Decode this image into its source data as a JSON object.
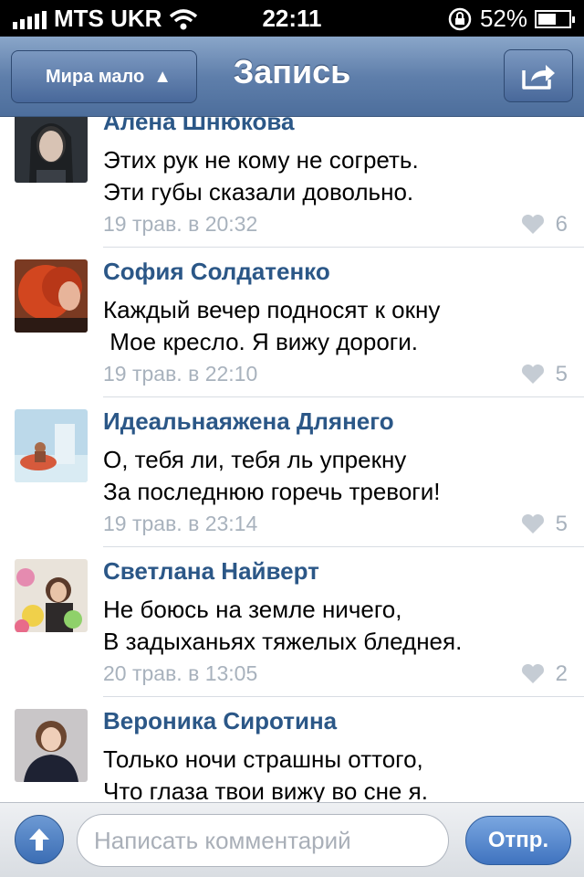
{
  "status_bar": {
    "carrier": "MTS UKR",
    "time": "22:11",
    "battery": "52%",
    "battery_level": 0.52,
    "signal_icon": "signal-bars-icon",
    "wifi_icon": "wifi-icon",
    "rotation_lock_icon": "rotation-lock-icon"
  },
  "nav": {
    "back_label": "Мира мало",
    "back_triangle": "▲",
    "title": "Запись",
    "share_icon": "share-icon"
  },
  "comments": [
    {
      "author": "Алена Шнюкова",
      "text": "Этих рук не кому не согреть.\nЭти губы сказали довольно.",
      "date": "19 трав. в 20:32",
      "likes": "6"
    },
    {
      "author": "София Солдатенко",
      "text": "Каждый вечер подносят к окну\n Мое кресло. Я вижу дороги.",
      "date": "19 трав. в 22:10",
      "likes": "5"
    },
    {
      "author": "Идеальнаяжена Длянего",
      "text": "О, тебя ли, тебя ль упрекну\nЗа последнюю горечь тревоги!",
      "date": "19 трав. в 23:14",
      "likes": "5"
    },
    {
      "author": "Светлана Найверт",
      "text": "Не боюсь на земле ничего,\nВ задыханьях тяжелых бледнея.",
      "date": "20 трав. в 13:05",
      "likes": "2"
    },
    {
      "author": "Вероника Сиротина",
      "text": "Только ночи страшны оттого,\nЧто глаза твои вижу во сне я.",
      "date": "",
      "likes": ""
    }
  ],
  "composer": {
    "placeholder": "Написать комментарий",
    "send_label": "Отпр.",
    "attach_icon": "arrow-up-icon"
  },
  "colors": {
    "nav_blue": "#5f7fab",
    "author_blue": "#2b5787",
    "meta_gray": "#a8b2bd"
  }
}
